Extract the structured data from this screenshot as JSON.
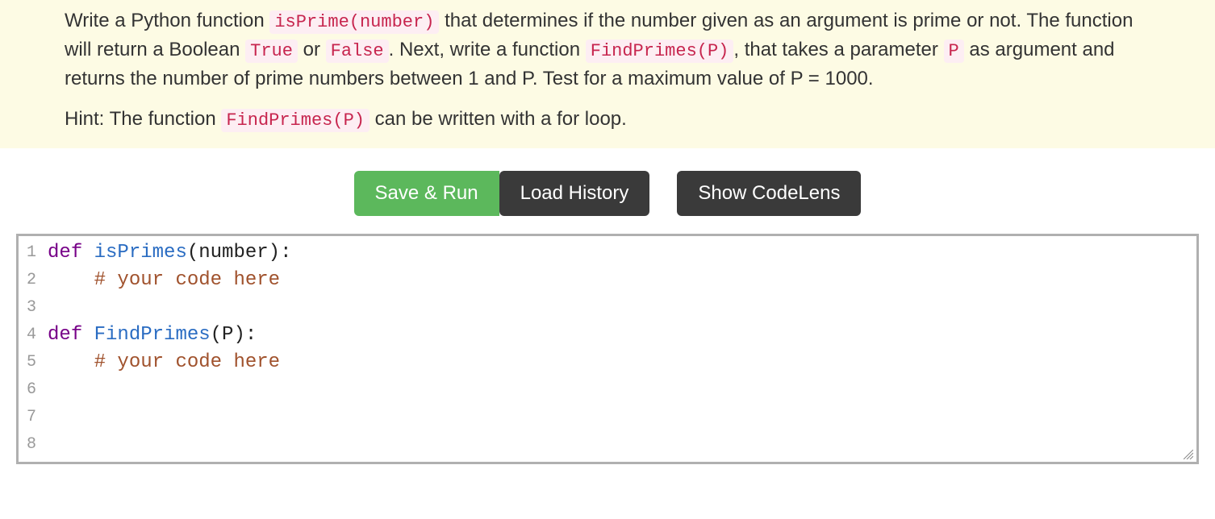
{
  "instructions": {
    "p1_1": "Write a Python function ",
    "p1_c1": "isPrime(number)",
    "p1_2": " that determines if the number given as an argument is prime or not. The function will return a Boolean ",
    "p1_c2": "True",
    "p1_3": " or ",
    "p1_c3": "False",
    "p1_4": ". Next, write a function ",
    "p1_c4": "FindPrimes(P)",
    "p1_5": ", that takes a parameter ",
    "p1_c5": "P",
    "p1_6": " as argument and returns the number of prime numbers between 1 and P. Test for a maximum value of P = 1000.",
    "p2_1": "Hint: The function ",
    "p2_c1": "FindPrimes(P)",
    "p2_2": " can be written with a for loop."
  },
  "toolbar": {
    "save_run": "Save & Run",
    "load_history": "Load History",
    "show_codelens": "Show CodeLens"
  },
  "editor": {
    "line_numbers": [
      "1",
      "2",
      "3",
      "4",
      "5",
      "6",
      "7",
      "8"
    ],
    "lines": [
      {
        "tokens": [
          {
            "t": "def ",
            "c": "kw"
          },
          {
            "t": "isPrimes",
            "c": "fn"
          },
          {
            "t": "(number):",
            "c": "paren"
          }
        ]
      },
      {
        "tokens": [
          {
            "t": "    ",
            "c": ""
          },
          {
            "t": "# your code here",
            "c": "comment"
          }
        ]
      },
      {
        "tokens": []
      },
      {
        "tokens": [
          {
            "t": "def ",
            "c": "kw"
          },
          {
            "t": "FindPrimes",
            "c": "fn"
          },
          {
            "t": "(P):",
            "c": "paren"
          }
        ]
      },
      {
        "tokens": [
          {
            "t": "    ",
            "c": ""
          },
          {
            "t": "# your code here",
            "c": "comment"
          }
        ]
      },
      {
        "tokens": []
      },
      {
        "tokens": []
      },
      {
        "tokens": []
      }
    ]
  }
}
